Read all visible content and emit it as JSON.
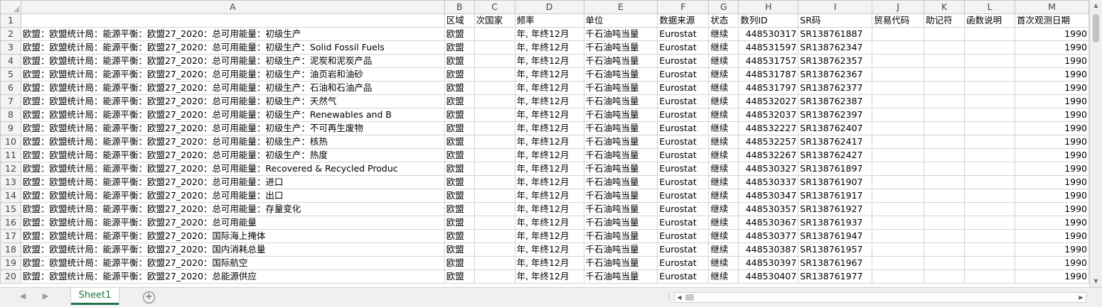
{
  "spreadsheet": {
    "column_headers": [
      "A",
      "B",
      "C",
      "D",
      "E",
      "F",
      "G",
      "H",
      "I",
      "J",
      "K",
      "L",
      "M"
    ],
    "header_row": [
      "",
      "区域",
      "次国家",
      "频率",
      "单位",
      "数据来源",
      "状态",
      "数列ID",
      "SR码",
      "贸易代码",
      "助记符",
      "函数说明",
      "首次观测日期"
    ],
    "prefix": "欧盟：欧盟统计局：能源平衡：欧盟27_2020：",
    "rows": [
      {
        "n": "2",
        "a": "欧盟：欧盟统计局：能源平衡：欧盟27_2020：总可用能量：初级生产",
        "b": "欧盟",
        "d": "年, 年终12月",
        "e": "千石油吨当量",
        "f": "Eurostat",
        "g": "继续",
        "h": "448530317",
        "i": "SR138761887",
        "m": "1990"
      },
      {
        "n": "3",
        "a": "欧盟：欧盟统计局：能源平衡：欧盟27_2020：总可用能量：初级生产：Solid Fossil Fuels",
        "b": "欧盟",
        "d": "年, 年终12月",
        "e": "千石油吨当量",
        "f": "Eurostat",
        "g": "继续",
        "h": "448531597",
        "i": "SR138762347",
        "m": "1990"
      },
      {
        "n": "4",
        "a": "欧盟：欧盟统计局：能源平衡：欧盟27_2020：总可用能量：初级生产：泥炭和泥炭产品",
        "b": "欧盟",
        "d": "年, 年终12月",
        "e": "千石油吨当量",
        "f": "Eurostat",
        "g": "继续",
        "h": "448531757",
        "i": "SR138762357",
        "m": "1990"
      },
      {
        "n": "5",
        "a": "欧盟：欧盟统计局：能源平衡：欧盟27_2020：总可用能量：初级生产：油页岩和油砂",
        "b": "欧盟",
        "d": "年, 年终12月",
        "e": "千石油吨当量",
        "f": "Eurostat",
        "g": "继续",
        "h": "448531787",
        "i": "SR138762367",
        "m": "1990"
      },
      {
        "n": "6",
        "a": "欧盟：欧盟统计局：能源平衡：欧盟27_2020：总可用能量：初级生产：石油和石油产品",
        "b": "欧盟",
        "d": "年, 年终12月",
        "e": "千石油吨当量",
        "f": "Eurostat",
        "g": "继续",
        "h": "448531797",
        "i": "SR138762377",
        "m": "1990"
      },
      {
        "n": "7",
        "a": "欧盟：欧盟统计局：能源平衡：欧盟27_2020：总可用能量：初级生产：天然气",
        "b": "欧盟",
        "d": "年, 年终12月",
        "e": "千石油吨当量",
        "f": "Eurostat",
        "g": "继续",
        "h": "448532027",
        "i": "SR138762387",
        "m": "1990"
      },
      {
        "n": "8",
        "a": "欧盟：欧盟统计局：能源平衡：欧盟27_2020：总可用能量：初级生产：Renewables and B",
        "b": "欧盟",
        "d": "年, 年终12月",
        "e": "千石油吨当量",
        "f": "Eurostat",
        "g": "继续",
        "h": "448532037",
        "i": "SR138762397",
        "m": "1990"
      },
      {
        "n": "9",
        "a": "欧盟：欧盟统计局：能源平衡：欧盟27_2020：总可用能量：初级生产：不可再生废物",
        "b": "欧盟",
        "d": "年, 年终12月",
        "e": "千石油吨当量",
        "f": "Eurostat",
        "g": "继续",
        "h": "448532227",
        "i": "SR138762407",
        "m": "1990"
      },
      {
        "n": "10",
        "a": "欧盟：欧盟统计局：能源平衡：欧盟27_2020：总可用能量：初级生产：核热",
        "b": "欧盟",
        "d": "年, 年终12月",
        "e": "千石油吨当量",
        "f": "Eurostat",
        "g": "继续",
        "h": "448532257",
        "i": "SR138762417",
        "m": "1990"
      },
      {
        "n": "11",
        "a": "欧盟：欧盟统计局：能源平衡：欧盟27_2020：总可用能量：初级生产：热度",
        "b": "欧盟",
        "d": "年, 年终12月",
        "e": "千石油吨当量",
        "f": "Eurostat",
        "g": "继续",
        "h": "448532267",
        "i": "SR138762427",
        "m": "1990"
      },
      {
        "n": "12",
        "a": "欧盟：欧盟统计局：能源平衡：欧盟27_2020：总可用能量：Recovered & Recycled Produc",
        "b": "欧盟",
        "d": "年, 年终12月",
        "e": "千石油吨当量",
        "f": "Eurostat",
        "g": "继续",
        "h": "448530327",
        "i": "SR138761897",
        "m": "1990"
      },
      {
        "n": "13",
        "a": "欧盟：欧盟统计局：能源平衡：欧盟27_2020：总可用能量：进口",
        "b": "欧盟",
        "d": "年, 年终12月",
        "e": "千石油吨当量",
        "f": "Eurostat",
        "g": "继续",
        "h": "448530337",
        "i": "SR138761907",
        "m": "1990"
      },
      {
        "n": "14",
        "a": "欧盟：欧盟统计局：能源平衡：欧盟27_2020：总可用能量：出口",
        "b": "欧盟",
        "d": "年, 年终12月",
        "e": "千石油吨当量",
        "f": "Eurostat",
        "g": "继续",
        "h": "448530347",
        "i": "SR138761917",
        "m": "1990"
      },
      {
        "n": "15",
        "a": "欧盟：欧盟统计局：能源平衡：欧盟27_2020：总可用能量：存量变化",
        "b": "欧盟",
        "d": "年, 年终12月",
        "e": "千石油吨当量",
        "f": "Eurostat",
        "g": "继续",
        "h": "448530357",
        "i": "SR138761927",
        "m": "1990"
      },
      {
        "n": "16",
        "a": "欧盟：欧盟统计局：能源平衡：欧盟27_2020：总可用能量",
        "b": "欧盟",
        "d": "年, 年终12月",
        "e": "千石油吨当量",
        "f": "Eurostat",
        "g": "继续",
        "h": "448530367",
        "i": "SR138761937",
        "m": "1990"
      },
      {
        "n": "17",
        "a": "欧盟：欧盟统计局：能源平衡：欧盟27_2020：国际海上掩体",
        "b": "欧盟",
        "d": "年, 年终12月",
        "e": "千石油吨当量",
        "f": "Eurostat",
        "g": "继续",
        "h": "448530377",
        "i": "SR138761947",
        "m": "1990"
      },
      {
        "n": "18",
        "a": "欧盟：欧盟统计局：能源平衡：欧盟27_2020：国内消耗总量",
        "b": "欧盟",
        "d": "年, 年终12月",
        "e": "千石油吨当量",
        "f": "Eurostat",
        "g": "继续",
        "h": "448530387",
        "i": "SR138761957",
        "m": "1990"
      },
      {
        "n": "19",
        "a": "欧盟：欧盟统计局：能源平衡：欧盟27_2020：国际航空",
        "b": "欧盟",
        "d": "年, 年终12月",
        "e": "千石油吨当量",
        "f": "Eurostat",
        "g": "继续",
        "h": "448530397",
        "i": "SR138761967",
        "m": "1990"
      },
      {
        "n": "20",
        "a": "欧盟：欧盟统计局：能源平衡：欧盟27_2020：总能源供应",
        "b": "欧盟",
        "d": "年, 年终12月",
        "e": "千石油吨当量",
        "f": "Eurostat",
        "g": "继续",
        "h": "448530407",
        "i": "SR138761977",
        "m": "1990"
      }
    ]
  },
  "sheet_tabs": [
    "Sheet1"
  ],
  "icons": {
    "add_sheet": "plus-circle-icon",
    "nav_prev": "triangle-left-icon",
    "nav_next": "triangle-right-icon"
  },
  "colors": {
    "active_tab": "#217346",
    "header_bg": "#f3f3f3",
    "gridline": "#d4d4d4"
  }
}
